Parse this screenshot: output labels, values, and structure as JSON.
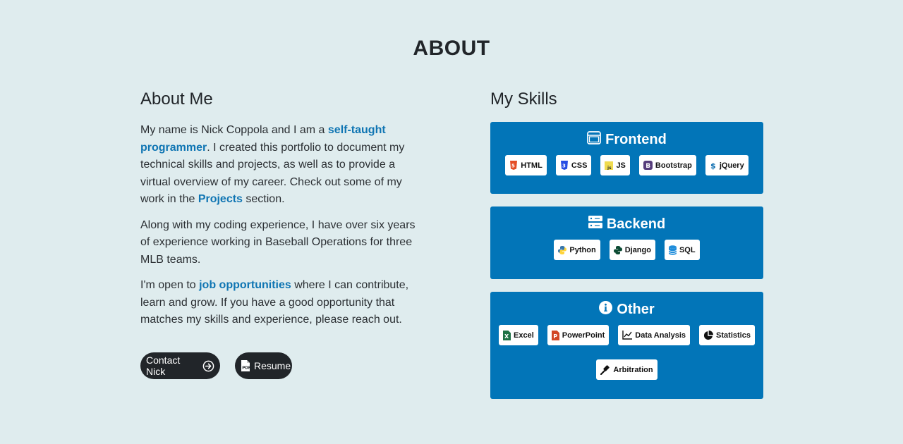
{
  "page_title": "ABOUT",
  "about": {
    "heading": "About Me",
    "p1_pre": "My name is Nick Coppola and I am a ",
    "p1_link": "self-taught programmer",
    "p1_mid": ". I created this portfolio to document my technical skills and projects, as well as to provide a virtual overview of my career. Check out some of my work in the ",
    "p1_link2": "Projects",
    "p1_post": " section.",
    "p2": "Along with my coding experience, I have over six years of experience working in Baseball Operations for three MLB teams.",
    "p3_pre": "I'm open to ",
    "p3_link": "job opportunities",
    "p3_post": " where I can contribute, learn and grow. If you have a good opportunity that matches my skills and experience, please reach out."
  },
  "buttons": {
    "contact": "Contact Nick",
    "resume": "Resume"
  },
  "skills": {
    "heading": "My Skills",
    "frontend": {
      "title": "Frontend",
      "items": [
        "HTML",
        "CSS",
        "JS",
        "Bootstrap",
        "jQuery"
      ]
    },
    "backend": {
      "title": "Backend",
      "items": [
        "Python",
        "Django",
        "SQL"
      ]
    },
    "other": {
      "title": "Other",
      "items": [
        "Excel",
        "PowerPoint",
        "Data Analysis",
        "Statistics",
        "Arbitration"
      ]
    }
  },
  "colors": {
    "background": "#dfecee",
    "accent": "#0275b8",
    "link": "#0f75b3",
    "button": "#212529"
  }
}
